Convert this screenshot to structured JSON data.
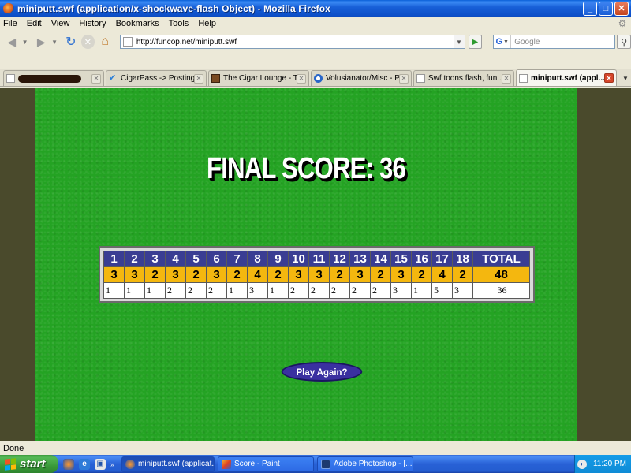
{
  "window": {
    "title": "miniputt.swf (application/x-shockwave-flash Object) - Mozilla Firefox",
    "btn_min": "_",
    "btn_max": "□",
    "btn_close": "✕"
  },
  "menu": [
    "File",
    "Edit",
    "View",
    "History",
    "Bookmarks",
    "Tools",
    "Help"
  ],
  "nav": {
    "url": "http://funcop.net/miniputt.swf",
    "search_placeholder": "Google",
    "search_engine_glyph": "G"
  },
  "tabs": [
    {
      "label": "",
      "redacted": true,
      "favicon": "generic"
    },
    {
      "label": "CigarPass -> Posting...",
      "favicon": "check"
    },
    {
      "label": "The Cigar Lounge - T...",
      "favicon": "image"
    },
    {
      "label": "Volusianator/Misc - P...",
      "favicon": "globe"
    },
    {
      "label": "Swf toons flash, fun...",
      "favicon": "page"
    },
    {
      "label": "miniputt.swf (appl...",
      "favicon": "page",
      "active": true
    }
  ],
  "game": {
    "final_score_label": "FINAL SCORE: 36",
    "holes": [
      "1",
      "2",
      "3",
      "4",
      "5",
      "6",
      "7",
      "8",
      "9",
      "10",
      "11",
      "12",
      "13",
      "14",
      "15",
      "16",
      "17",
      "18"
    ],
    "total_label": "TOTAL",
    "par": [
      "3",
      "3",
      "2",
      "3",
      "2",
      "3",
      "2",
      "4",
      "2",
      "3",
      "3",
      "2",
      "3",
      "2",
      "3",
      "2",
      "4",
      "2"
    ],
    "par_total": "48",
    "strokes": [
      "1",
      "1",
      "1",
      "2",
      "2",
      "2",
      "1",
      "3",
      "1",
      "2",
      "2",
      "2",
      "2",
      "2",
      "3",
      "1",
      "5",
      "3"
    ],
    "strokes_total": "36",
    "play_again_label": "Play Again?"
  },
  "status": {
    "text": "Done"
  },
  "taskbar": {
    "start_label": "start",
    "quicklaunch_more": "»",
    "tasks": [
      {
        "label": "miniputt.swf (applicat...",
        "active": true
      },
      {
        "label": "Score - Paint",
        "active": false
      },
      {
        "label": "Adobe Photoshop - [...",
        "active": false
      }
    ],
    "clock": "11:20 PM"
  },
  "colors": {
    "felt_green": "#24a323",
    "hole_row_blue": "#3a3d93",
    "par_row_gold": "#f4b70f",
    "play_button_purple": "#3a30a0"
  }
}
